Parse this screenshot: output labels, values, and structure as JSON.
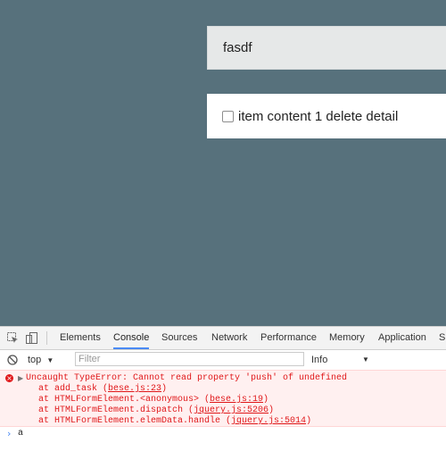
{
  "app": {
    "input_value": "fasdf",
    "todo": {
      "text": "item content 1 delete detail",
      "checked": false
    }
  },
  "devtools": {
    "tabs": [
      "Elements",
      "Console",
      "Sources",
      "Network",
      "Performance",
      "Memory",
      "Application",
      "S"
    ],
    "active_tab": "Console",
    "context": "top",
    "filter_placeholder": "Filter",
    "level": "Info",
    "error": {
      "message": "Uncaught TypeError: Cannot read property 'push' of undefined",
      "stack": [
        {
          "prefix": "at add_task (",
          "link": "bese.js:23",
          "suffix": ")"
        },
        {
          "prefix": "at HTMLFormElement.<anonymous> (",
          "link": "bese.js:19",
          "suffix": ")"
        },
        {
          "prefix": "at HTMLFormElement.dispatch (",
          "link": "jquery.js:5206",
          "suffix": ")"
        },
        {
          "prefix": "at HTMLFormElement.elemData.handle (",
          "link": "jquery.js:5014",
          "suffix": ")"
        }
      ]
    },
    "prompt_input": "a"
  },
  "colors": {
    "page_bg": "#57717c",
    "error_text": "#e0181a",
    "error_bg": "#fff0f0",
    "accent": "#4a8af4"
  }
}
